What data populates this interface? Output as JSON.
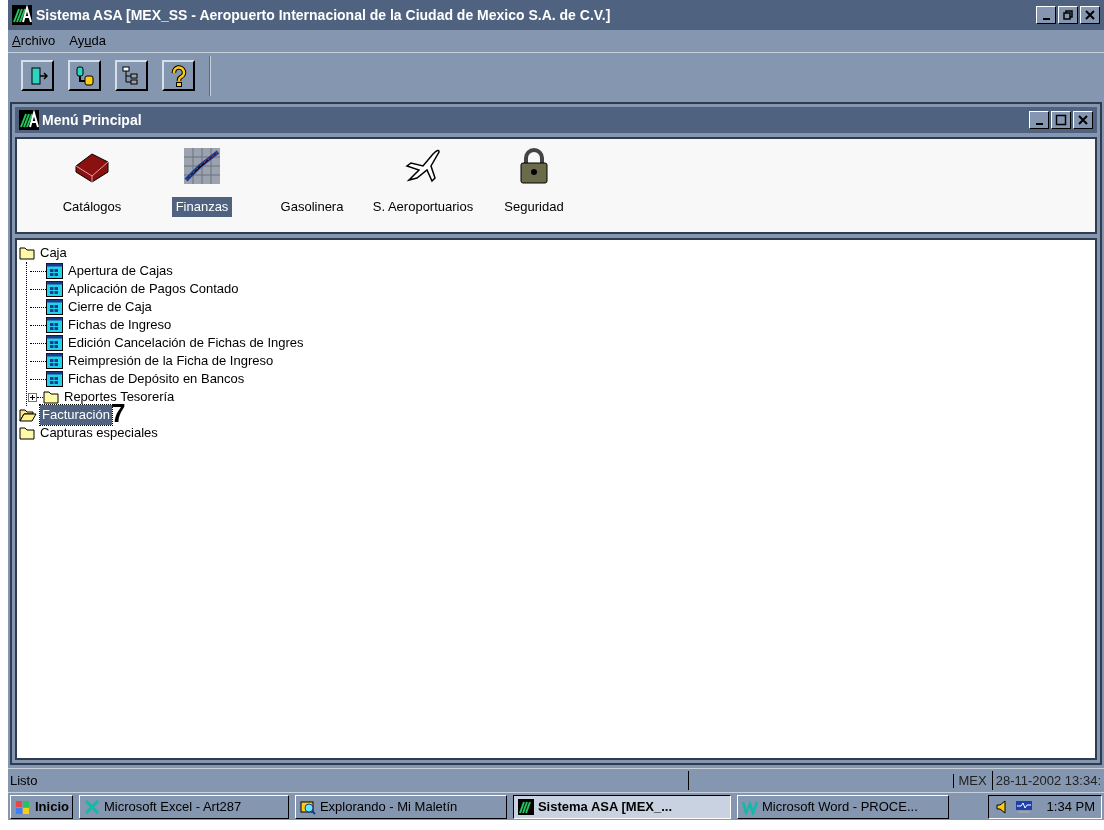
{
  "window": {
    "title": "Sistema ASA [MEX_SS - Aeropuerto Internacional de la Ciudad de Mexico S.A. de C.V.]",
    "controls": [
      {
        "kind": "minimize"
      },
      {
        "kind": "restore"
      },
      {
        "kind": "close"
      }
    ]
  },
  "menu": [
    {
      "label_parts": [
        {
          "text": "A",
          "underlined": true
        },
        {
          "text": "rchivo",
          "underlined": false
        }
      ]
    },
    {
      "label_parts": [
        {
          "text": "Ay",
          "underlined": false
        },
        {
          "text": "u",
          "underlined": true
        },
        {
          "text": "da",
          "underlined": false
        }
      ]
    }
  ],
  "toolbar": [
    {
      "kind": "exit"
    },
    {
      "kind": "connect"
    },
    {
      "kind": "tree"
    },
    {
      "kind": "help"
    }
  ],
  "child_window": {
    "title": "Menú Principal",
    "controls": [
      {
        "kind": "minimize"
      },
      {
        "kind": "maximize"
      },
      {
        "kind": "close"
      }
    ],
    "modules": [
      {
        "label": "Catálogos",
        "kind": "book",
        "selected": false
      },
      {
        "label": "Finanzas",
        "kind": "chart",
        "selected": true
      },
      {
        "label": "Gasolinera",
        "kind": "none",
        "selected": false
      },
      {
        "label": "S. Aeroportuarios",
        "kind": "plane",
        "selected": false
      },
      {
        "label": "Seguridad",
        "kind": "lock",
        "selected": false
      }
    ],
    "tree": [
      {
        "label": "Caja",
        "kind": "folder",
        "expanded": true,
        "selected": false,
        "children": [
          {
            "label": "Apertura de Cajas",
            "kind": "form",
            "selected": false
          },
          {
            "label": "Aplicación de Pagos Contado",
            "kind": "form",
            "selected": false
          },
          {
            "label": "Cierre de Caja",
            "kind": "form",
            "selected": false
          },
          {
            "label": "Fichas de Ingreso",
            "kind": "form",
            "selected": false
          },
          {
            "label": "Edición Cancelación de Fichas de Ingres",
            "kind": "form",
            "selected": false
          },
          {
            "label": "Reimpresión de la Ficha de Ingreso",
            "kind": "form",
            "selected": false
          },
          {
            "label": "Fichas de Depósito en Bancos",
            "kind": "form",
            "selected": false
          },
          {
            "label": "Reportes Tesorería",
            "kind": "folder",
            "expanded": false,
            "selected": false
          }
        ]
      },
      {
        "label": "Facturación",
        "kind": "folder",
        "selected": true,
        "annotation": "7"
      },
      {
        "label": "Capturas especiales",
        "kind": "folder",
        "selected": false
      }
    ]
  },
  "status_bar": [
    "Listo",
    "MEX",
    "28-11-2002 13:34:"
  ],
  "taskbar": {
    "start": "Inicio",
    "tasks": [
      {
        "label": "Microsoft Excel - Art287",
        "kind": "excel",
        "selected": false
      },
      {
        "label": "Explorando - Mi Maletín",
        "kind": "explorer",
        "selected": false
      },
      {
        "label": "Sistema ASA [MEX_...",
        "kind": "asa",
        "selected": true
      },
      {
        "label": "Microsoft Word - PROCE...",
        "kind": "word",
        "selected": false
      }
    ],
    "clock": "1:34 PM"
  }
}
